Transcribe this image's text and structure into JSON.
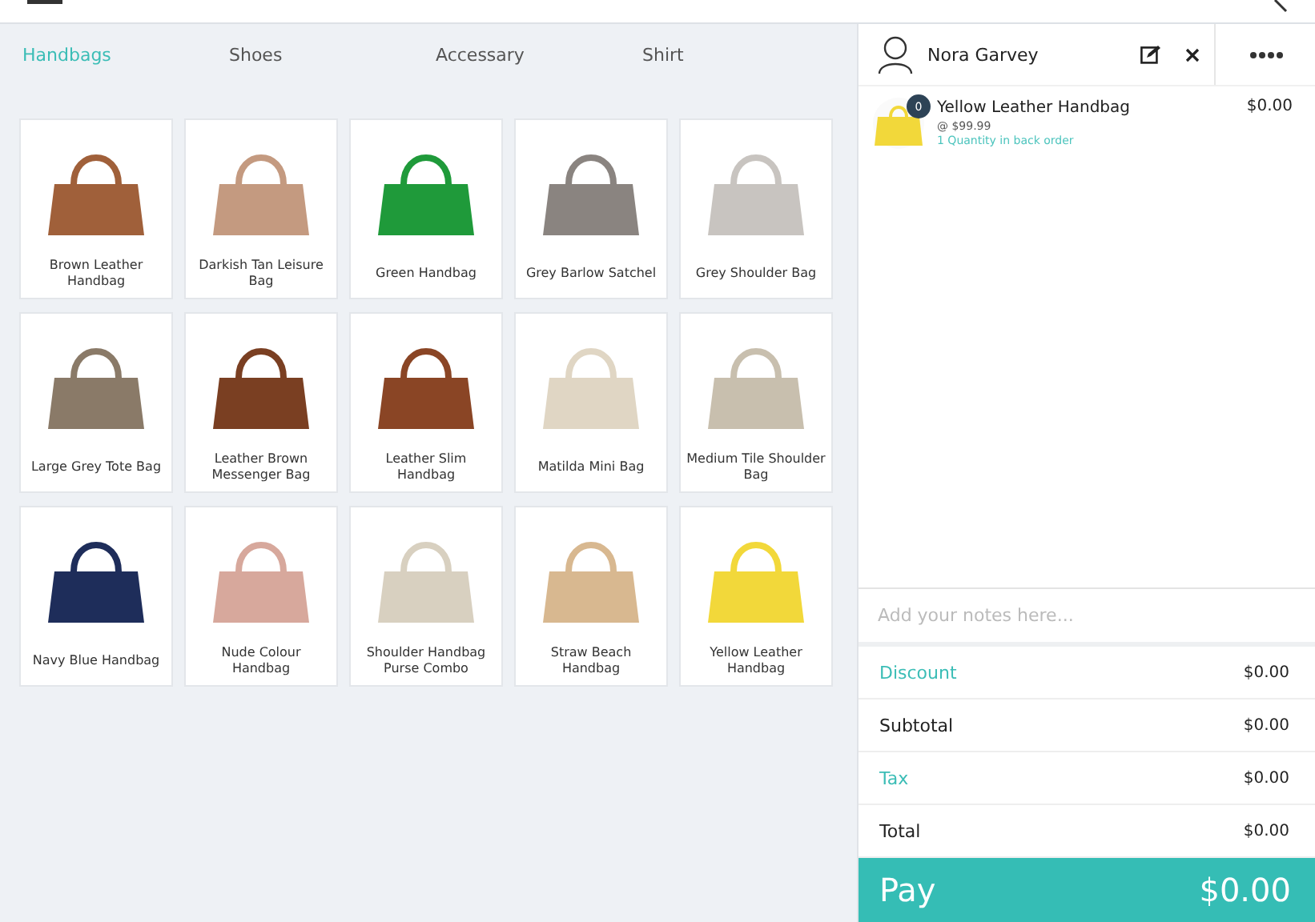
{
  "tabs": [
    {
      "label": "Handbags",
      "selected": true
    },
    {
      "label": "Shoes",
      "selected": false
    },
    {
      "label": "Accessary",
      "selected": false
    },
    {
      "label": "Shirt",
      "selected": false
    }
  ],
  "products": [
    {
      "name": "Brown Leather Handbag",
      "color": "#a0603a"
    },
    {
      "name": "Darkish Tan Leisure Bag",
      "color": "#c49a80"
    },
    {
      "name": "Green Handbag",
      "color": "#1f9a3a"
    },
    {
      "name": "Grey Barlow Satchel",
      "color": "#8a8480"
    },
    {
      "name": "Grey Shoulder Bag",
      "color": "#c8c4c0"
    },
    {
      "name": "Large Grey Tote Bag",
      "color": "#8a7a68"
    },
    {
      "name": "Leather Brown Messenger Bag",
      "color": "#7a3f22"
    },
    {
      "name": "Leather Slim Handbag",
      "color": "#8a4525"
    },
    {
      "name": "Matilda Mini Bag",
      "color": "#e0d6c4"
    },
    {
      "name": "Medium Tile Shoulder Bag",
      "color": "#c8bfae"
    },
    {
      "name": "Navy Blue Handbag",
      "color": "#1e2d5a"
    },
    {
      "name": "Nude Colour Handbag",
      "color": "#d7a89c"
    },
    {
      "name": "Shoulder Handbag Purse Combo",
      "color": "#d8d0c0"
    },
    {
      "name": "Straw Beach Handbag",
      "color": "#d8b890"
    },
    {
      "name": "Yellow Leather Handbag",
      "color": "#f2d83a"
    }
  ],
  "customer": {
    "name": "Nora Garvey"
  },
  "cart_items": [
    {
      "name": "Yellow Leather Handbag",
      "badge": "0",
      "unit_price": "@ $99.99",
      "note": "1 Quantity in back order",
      "price": "$0.00",
      "color": "#f2d83a"
    }
  ],
  "notes": {
    "placeholder": "Add your notes here..."
  },
  "summary": [
    {
      "label": "Discount",
      "value": "$0.00",
      "kind": "link"
    },
    {
      "label": "Subtotal",
      "value": "$0.00",
      "kind": "plain"
    },
    {
      "label": "Tax",
      "value": "$0.00",
      "kind": "link"
    },
    {
      "label": "Total",
      "value": "$0.00",
      "kind": "plain"
    }
  ],
  "pay": {
    "label": "Pay",
    "amount": "$0.00"
  }
}
